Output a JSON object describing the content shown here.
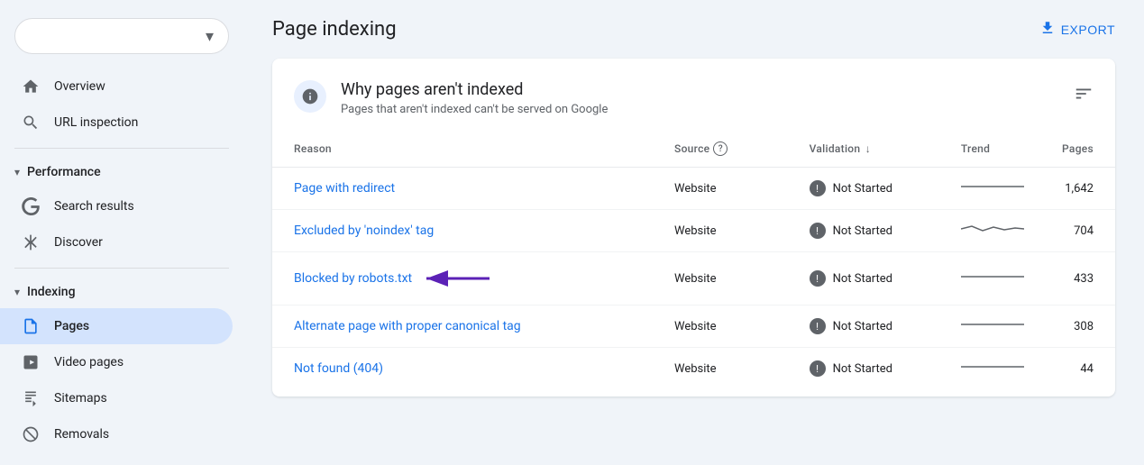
{
  "sidebar": {
    "dropdown": {
      "placeholder": ""
    },
    "items": [
      {
        "id": "overview",
        "label": "Overview",
        "icon": "home",
        "active": false,
        "section": null
      },
      {
        "id": "url-inspection",
        "label": "URL inspection",
        "icon": "search",
        "active": false,
        "section": null
      },
      {
        "id": "performance-header",
        "label": "Performance",
        "icon": "chevron",
        "active": false,
        "section": "header"
      },
      {
        "id": "search-results",
        "label": "Search results",
        "icon": "google-g",
        "active": false,
        "section": "performance"
      },
      {
        "id": "discover",
        "label": "Discover",
        "icon": "asterisk",
        "active": false,
        "section": "performance"
      },
      {
        "id": "indexing-header",
        "label": "Indexing",
        "icon": "chevron",
        "active": false,
        "section": "header"
      },
      {
        "id": "pages",
        "label": "Pages",
        "icon": "file",
        "active": true,
        "section": "indexing"
      },
      {
        "id": "video-pages",
        "label": "Video pages",
        "icon": "video",
        "active": false,
        "section": "indexing"
      },
      {
        "id": "sitemaps",
        "label": "Sitemaps",
        "icon": "sitemap",
        "active": false,
        "section": "indexing"
      },
      {
        "id": "removals",
        "label": "Removals",
        "icon": "removals",
        "active": false,
        "section": "indexing"
      }
    ]
  },
  "main": {
    "page_title": "Page indexing",
    "export_label": "EXPORT",
    "card": {
      "heading": "Why pages aren't indexed",
      "subheading": "Pages that aren't indexed can't be served on Google",
      "table": {
        "columns": [
          "Reason",
          "Source",
          "Validation",
          "Trend",
          "Pages"
        ],
        "rows": [
          {
            "reason": "Page with redirect",
            "source": "Website",
            "validation": "Not Started",
            "pages": "1,642",
            "trend_type": "flat",
            "highlighted": false
          },
          {
            "reason": "Excluded by 'noindex' tag",
            "source": "Website",
            "validation": "Not Started",
            "pages": "704",
            "trend_type": "wavy",
            "highlighted": false
          },
          {
            "reason": "Blocked by robots.txt",
            "source": "Website",
            "validation": "Not Started",
            "pages": "433",
            "trend_type": "flat",
            "highlighted": true,
            "has_arrow": true
          },
          {
            "reason": "Alternate page with proper canonical tag",
            "source": "Website",
            "validation": "Not Started",
            "pages": "308",
            "trend_type": "flat",
            "highlighted": false
          },
          {
            "reason": "Not found (404)",
            "source": "Website",
            "validation": "Not Started",
            "pages": "44",
            "trend_type": "flat",
            "highlighted": false
          }
        ]
      }
    }
  },
  "icons": {
    "home": "🏠",
    "search": "🔍",
    "google_g": "G",
    "asterisk": "✳",
    "file": "📄",
    "video": "🎬",
    "sitemap": "📊",
    "removals": "🚫",
    "info": "i",
    "filter": "≡",
    "export_arrow": "⬇",
    "not_started": "!"
  }
}
